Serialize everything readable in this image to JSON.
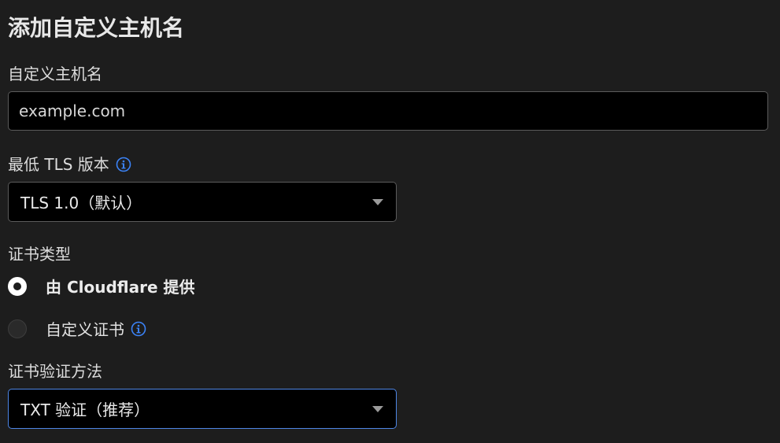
{
  "form": {
    "title": "添加自定义主机名",
    "hostname": {
      "label": "自定义主机名",
      "value": "",
      "placeholder": "example.com"
    },
    "min_tls": {
      "label": "最低 TLS 版本",
      "info_icon": "info-circle-icon",
      "selected": "TLS 1.0（默认）"
    },
    "cert_type": {
      "label": "证书类型",
      "options": [
        {
          "label": "由 Cloudflare 提供",
          "checked": true
        },
        {
          "label": "自定义证书",
          "checked": false,
          "info_icon": "info-circle-icon"
        }
      ]
    },
    "validation": {
      "label": "证书验证方法",
      "selected": "TXT 验证（推荐）"
    }
  },
  "colors": {
    "background": "#1d1d1d",
    "input_background": "#000000",
    "input_border": "#5b5b5b",
    "focus_border": "#4e86e6",
    "info_icon": "#3b82f6"
  }
}
